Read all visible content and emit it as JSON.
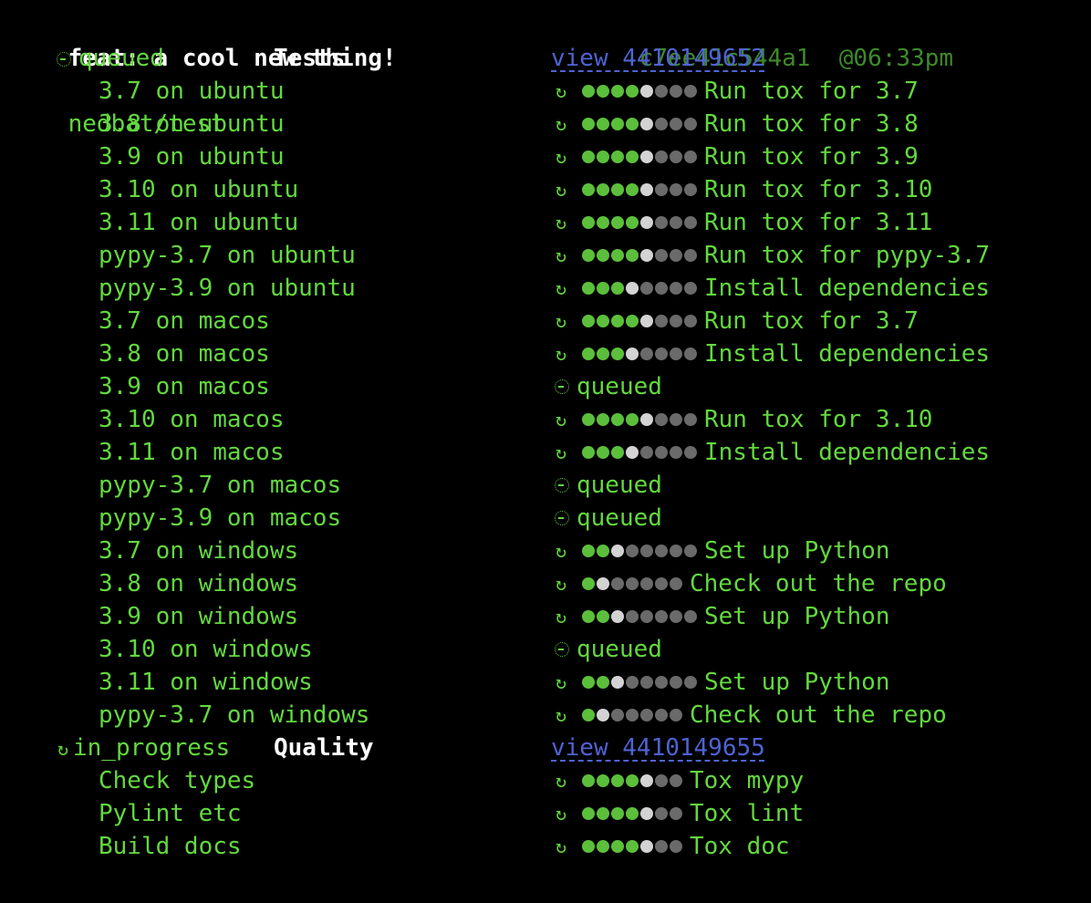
{
  "header": {
    "title": "feat: a cool new thing!",
    "repo": "nedbat/test",
    "sha": "c7ee41c544a1",
    "time": "@06:33pm"
  },
  "colors": {
    "background": "#000000",
    "text_green": "#63d83f",
    "dark_green": "#3e8a2a",
    "link_blue": "#4f63d2",
    "dot_done": "#5cbf3c",
    "dot_current": "#d3d3d3",
    "dot_pending": "#6a6a6a"
  },
  "workflows": [
    {
      "status_icon": "clock-icon",
      "status": "queued",
      "name": "Tests",
      "view_label": "view 4410149652",
      "jobs": [
        {
          "name": "3.7 on ubuntu",
          "icon": "running-icon",
          "done": 4,
          "total": 8,
          "step": "Run tox for 3.7"
        },
        {
          "name": "3.8 on ubuntu",
          "icon": "running-icon",
          "done": 4,
          "total": 8,
          "step": "Run tox for 3.8"
        },
        {
          "name": "3.9 on ubuntu",
          "icon": "running-icon",
          "done": 4,
          "total": 8,
          "step": "Run tox for 3.9"
        },
        {
          "name": "3.10 on ubuntu",
          "icon": "running-icon",
          "done": 4,
          "total": 8,
          "step": "Run tox for 3.10"
        },
        {
          "name": "3.11 on ubuntu",
          "icon": "running-icon",
          "done": 4,
          "total": 8,
          "step": "Run tox for 3.11"
        },
        {
          "name": "pypy-3.7 on ubuntu",
          "icon": "running-icon",
          "done": 4,
          "total": 8,
          "step": "Run tox for pypy-3.7"
        },
        {
          "name": "pypy-3.9 on ubuntu",
          "icon": "running-icon",
          "done": 3,
          "total": 8,
          "step": "Install dependencies"
        },
        {
          "name": "3.7 on macos",
          "icon": "running-icon",
          "done": 4,
          "total": 8,
          "step": "Run tox for 3.7"
        },
        {
          "name": "3.8 on macos",
          "icon": "running-icon",
          "done": 3,
          "total": 8,
          "step": "Install dependencies"
        },
        {
          "name": "3.9 on macos",
          "icon": "clock-icon",
          "status": "queued"
        },
        {
          "name": "3.10 on macos",
          "icon": "running-icon",
          "done": 4,
          "total": 8,
          "step": "Run tox for 3.10"
        },
        {
          "name": "3.11 on macos",
          "icon": "running-icon",
          "done": 3,
          "total": 8,
          "step": "Install dependencies"
        },
        {
          "name": "pypy-3.7 on macos",
          "icon": "clock-icon",
          "status": "queued"
        },
        {
          "name": "pypy-3.9 on macos",
          "icon": "clock-icon",
          "status": "queued"
        },
        {
          "name": "3.7 on windows",
          "icon": "running-icon",
          "done": 2,
          "total": 8,
          "step": "Set up Python"
        },
        {
          "name": "3.8 on windows",
          "icon": "running-icon",
          "done": 1,
          "total": 7,
          "step": "Check out the repo"
        },
        {
          "name": "3.9 on windows",
          "icon": "running-icon",
          "done": 2,
          "total": 8,
          "step": "Set up Python"
        },
        {
          "name": "3.10 on windows",
          "icon": "clock-icon",
          "status": "queued"
        },
        {
          "name": "3.11 on windows",
          "icon": "running-icon",
          "done": 2,
          "total": 8,
          "step": "Set up Python"
        },
        {
          "name": "pypy-3.7 on windows",
          "icon": "running-icon",
          "done": 1,
          "total": 7,
          "step": "Check out the repo"
        }
      ]
    },
    {
      "status_icon": "running-icon",
      "status": "in_progress",
      "name": "Quality",
      "view_label": "view 4410149655",
      "jobs": [
        {
          "name": "Check types",
          "icon": "running-icon",
          "done": 4,
          "total": 7,
          "step": "Tox mypy"
        },
        {
          "name": "Pylint etc",
          "icon": "running-icon",
          "done": 4,
          "total": 7,
          "step": "Tox lint"
        },
        {
          "name": "Build docs",
          "icon": "running-icon",
          "done": 4,
          "total": 7,
          "step": "Tox doc"
        }
      ]
    }
  ]
}
